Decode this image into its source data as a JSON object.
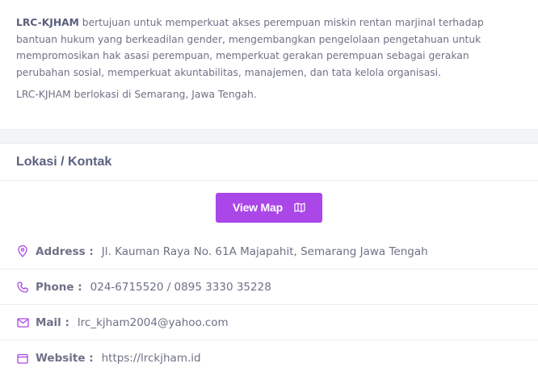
{
  "about": {
    "org_name": "LRC-KJHAM",
    "paragraph1_rest": " bertujuan untuk memperkuat akses perempuan miskin rentan marjinal terhadap bantuan hukum yang berkeadilan gender, mengembangkan pengelolaan pengetahuan untuk mempromosikan hak asasi perempuan, memperkuat gerakan perempuan sebagai gerakan perubahan sosial, memperkuat akuntabilitas, manajemen, dan tata kelola organisasi.",
    "paragraph2": "LRC-KJHAM berlokasi di Semarang, Jawa Tengah."
  },
  "section": {
    "title": "Lokasi / Kontak"
  },
  "map_button": {
    "label": "View Map",
    "icon": "map-icon"
  },
  "contacts": [
    {
      "icon": "map-pin-icon",
      "label": "Address :",
      "value": "Jl. Kauman Raya No. 61A Majapahit, Semarang Jawa Tengah"
    },
    {
      "icon": "phone-icon",
      "label": "Phone :",
      "value": "024-6715520 / 0895 3330 35228"
    },
    {
      "icon": "mail-icon",
      "label": "Mail :",
      "value": "lrc_kjham2004@yahoo.com"
    },
    {
      "icon": "calendar-icon",
      "label": "Website :",
      "value": "https://lrckjham.id"
    }
  ],
  "colors": {
    "accent": "#ab47e8",
    "text": "#6e7186",
    "heading": "#5b6180"
  }
}
